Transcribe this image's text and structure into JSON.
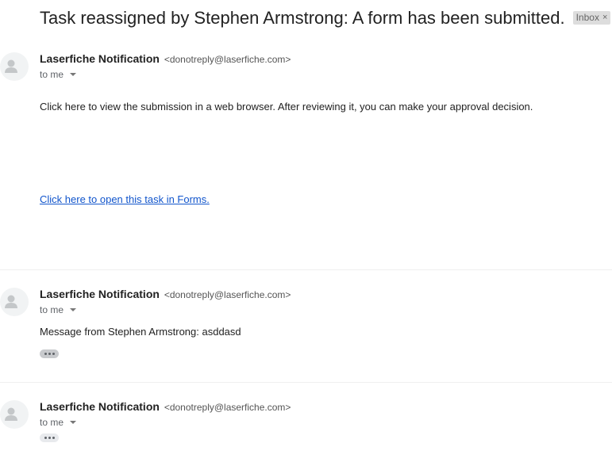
{
  "thread": {
    "subject": "Task reassigned by Stephen Armstrong: A form has been submitted.",
    "label": "Inbox",
    "label_remove": "×"
  },
  "messages": [
    {
      "sender_name": "Laserfiche Notification",
      "sender_email": "<donotreply@laserfiche.com>",
      "to": "to me",
      "body": "Click here to view the submission in a web browser. After reviewing it, you can make your approval decision.",
      "link": "Click here to open this task in Forms."
    },
    {
      "sender_name": "Laserfiche Notification",
      "sender_email": "<donotreply@laserfiche.com>",
      "to": "to me",
      "body": "Message from Stephen Armstrong: asddasd"
    },
    {
      "sender_name": "Laserfiche Notification",
      "sender_email": "<donotreply@laserfiche.com>",
      "to": "to me"
    }
  ],
  "icons": {
    "avatar": "person-silhouette-icon",
    "caret": "caret-down-icon",
    "trimmed": "more-horizontal-icon"
  },
  "colors": {
    "link": "#1155cc",
    "label_bg": "#dddddd",
    "avatar_bg": "#f1f3f4"
  }
}
